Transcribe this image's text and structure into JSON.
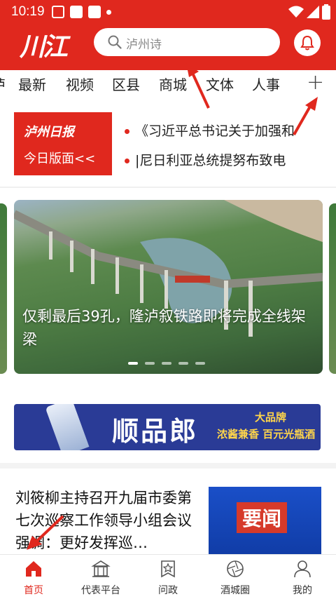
{
  "status_bar": {
    "time": "10:19"
  },
  "header": {
    "logo": "川江",
    "search_placeholder": "泸州诗"
  },
  "tabs": [
    {
      "label": "最新"
    },
    {
      "label": "视频"
    },
    {
      "label": "区县"
    },
    {
      "label": "商城"
    },
    {
      "label": "文体"
    },
    {
      "label": "人事"
    }
  ],
  "tab_partial": "泸",
  "tab_more": "+",
  "newspaper": {
    "line1": "泸州日报",
    "line2": "今日版面<<"
  },
  "headlines": [
    "《习近平总书记关于加强和",
    "|尼日利亚总统提努布致电"
  ],
  "carousel": {
    "caption": "仅剩最后39孔，隆泸叙铁路即将完成全线架梁",
    "pages": 5,
    "active_page": 1
  },
  "ad": {
    "brand": "顺品郎",
    "slogan1": "大品牌",
    "slogan2": "浓酱兼香 百元光瓶酒"
  },
  "article": {
    "title": "刘筱柳主持召开九届市委第七次巡察工作领导小组会议强调：更好发挥巡…",
    "thumb_label": "要闻"
  },
  "bottom_nav": [
    {
      "label": "首页",
      "icon": "home-icon",
      "active": true
    },
    {
      "label": "代表平台",
      "icon": "building-icon",
      "active": false
    },
    {
      "label": "问政",
      "icon": "badge-star-icon",
      "active": false
    },
    {
      "label": "酒城圈",
      "icon": "aperture-icon",
      "active": false
    },
    {
      "label": "我的",
      "icon": "user-icon",
      "active": false
    }
  ],
  "colors": {
    "brand_red": "#e0281e",
    "ad_blue": "#2a3b96"
  }
}
